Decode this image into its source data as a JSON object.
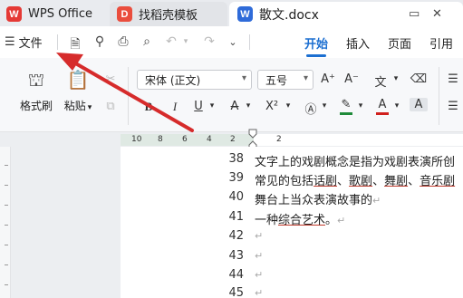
{
  "tabs": [
    {
      "label": "WPS Office",
      "logo": "W"
    },
    {
      "label": "找稻壳模板",
      "logo": "D"
    },
    {
      "label": "散文.docx",
      "logo": "W"
    }
  ],
  "menubar": {
    "file_label": "文件",
    "tabs": [
      "开始",
      "插入",
      "页面",
      "引用"
    ],
    "active_tab": "开始"
  },
  "ribbon": {
    "format_painter": "格式刷",
    "paste": "粘贴",
    "paste_caret": "▾",
    "font_name": "宋体 (正文)",
    "font_size": "五号",
    "highlight_color": "#1f8b3a",
    "font_color": "#d0201d"
  },
  "ruler": {
    "ticks": [
      "10",
      "8",
      "6",
      "4",
      "2",
      "2"
    ]
  },
  "document": {
    "lines": [
      {
        "num": "38",
        "text": "文字上的戏剧概念是指为戏剧表演所创"
      },
      {
        "num": "39",
        "text": "常见的包括话剧、歌剧、舞剧、音乐剧"
      },
      {
        "num": "40",
        "text": "舞台上当众表演故事的"
      },
      {
        "num": "41",
        "text": "一种综合艺术。"
      },
      {
        "num": "42",
        "text": ""
      },
      {
        "num": "43",
        "text": ""
      },
      {
        "num": "44",
        "text": ""
      },
      {
        "num": "45",
        "text": ""
      }
    ],
    "line39_parts": [
      "常见的包括",
      "话剧",
      "、",
      "歌剧",
      "、",
      "舞剧",
      "、",
      "音乐剧"
    ],
    "line41_parts": [
      "一种",
      "综合艺术",
      "。"
    ],
    "paragraph_mark": "↵"
  },
  "annotation": {
    "color": "#d62b2b"
  }
}
